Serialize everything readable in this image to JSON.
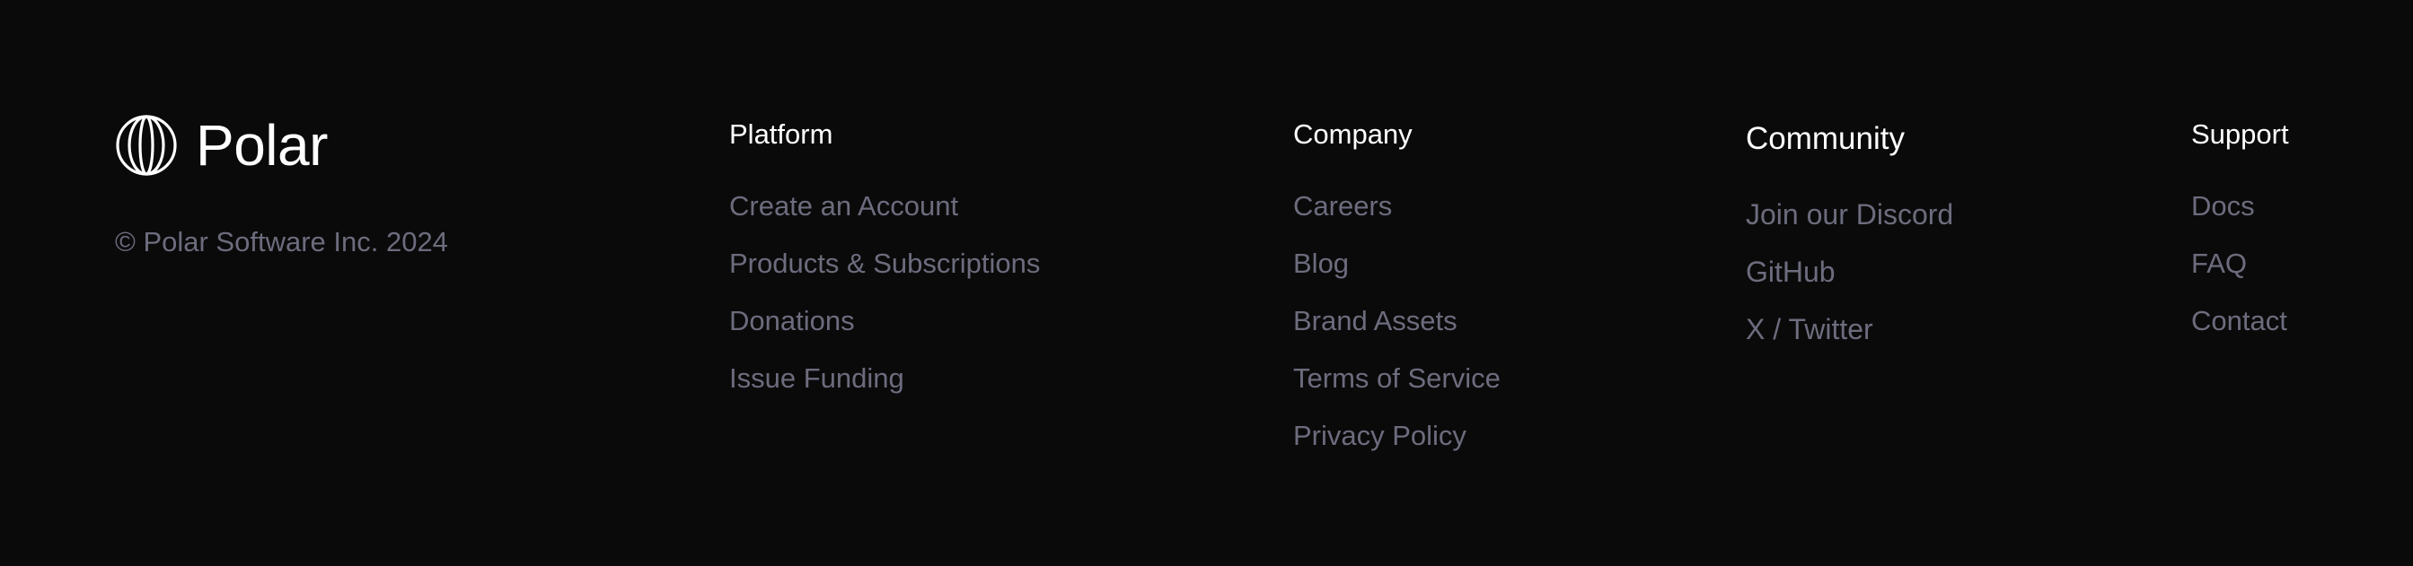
{
  "brand": {
    "name": "Polar",
    "logo_icon": "polar-globe-icon",
    "copyright": "© Polar Software Inc. 2024"
  },
  "columns": {
    "platform": {
      "title": "Platform",
      "links": [
        "Create an Account",
        "Products & Subscriptions",
        "Donations",
        "Issue Funding"
      ]
    },
    "company": {
      "title": "Company",
      "links": [
        "Careers",
        "Blog",
        "Brand Assets",
        "Terms of Service",
        "Privacy Policy"
      ]
    },
    "community": {
      "title": "Community",
      "links": [
        "Join our Discord",
        "GitHub",
        "X / Twitter"
      ]
    },
    "support": {
      "title": "Support",
      "links": [
        "Docs",
        "FAQ",
        "Contact"
      ]
    }
  },
  "colors": {
    "background": "#0a0a0a",
    "heading": "#ffffff",
    "link": "#6c6c7e"
  }
}
